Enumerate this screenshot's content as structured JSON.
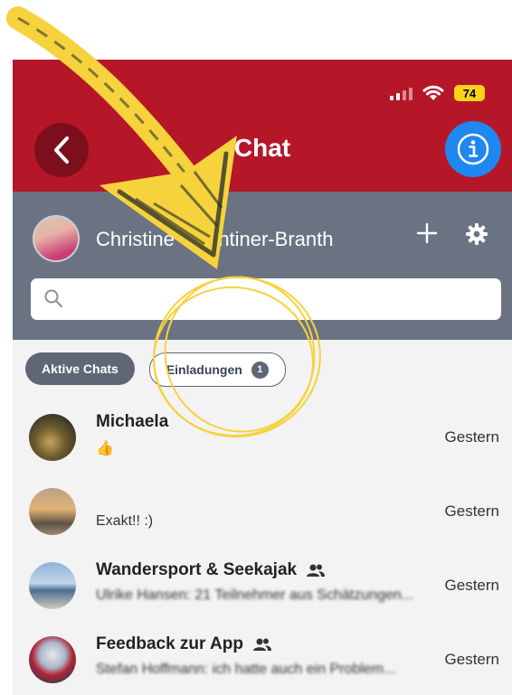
{
  "status": {
    "time": "",
    "battery": "74"
  },
  "header": {
    "title": "Chat"
  },
  "user": {
    "name": "Christine Valentiner-Branth"
  },
  "search": {
    "placeholder": ""
  },
  "tabs": [
    {
      "label": "Aktive Chats"
    },
    {
      "label": "Einladungen",
      "badge": "1"
    }
  ],
  "chats": [
    {
      "name": "Michaela",
      "message": "👍",
      "time": "Gestern",
      "group": false
    },
    {
      "name": "",
      "message": "Exakt!! :)",
      "time": "Gestern",
      "group": false
    },
    {
      "name": "Wandersport & Seekajak",
      "message": "Ulrike Hansen: 21 Teilnehmer aus Schätzungen...",
      "time": "Gestern",
      "group": true
    },
    {
      "name": "Feedback zur App",
      "message": "Stefan Hoffmann: ich hatte auch ein Problem...",
      "time": "Gestern",
      "group": true
    }
  ],
  "colors": {
    "brand": "#b51728",
    "userbar": "#6b7383",
    "info": "#1e87f0",
    "annotation": "#f6d23c"
  },
  "icons": [
    "back-chevron-icon",
    "info-icon",
    "plus-icon",
    "gear-icon",
    "search-icon",
    "group-icon"
  ]
}
